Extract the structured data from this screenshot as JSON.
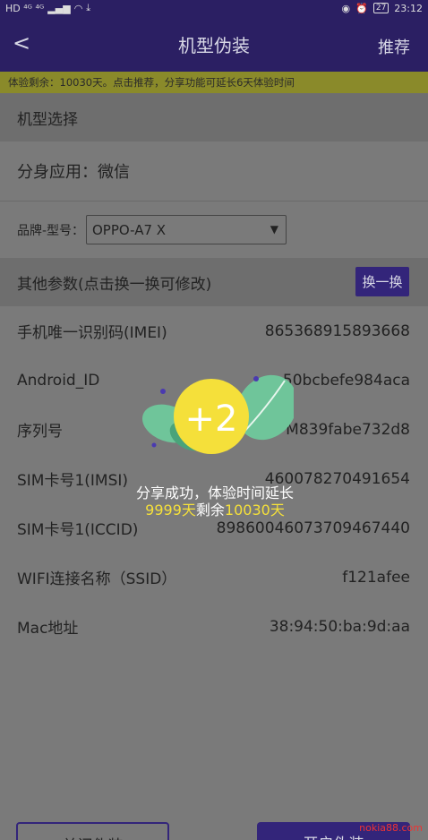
{
  "status": {
    "left": "HD ⁴ᴳ ⁴ᴳ",
    "battery": "27",
    "time": "23:12"
  },
  "appbar": {
    "back": "<",
    "title": "机型伪装",
    "action": "推荐"
  },
  "trial_banner": "体验剩余：10030天。点击推荐，分享功能可延长6天体验时间",
  "section_model": "机型选择",
  "clone_app": "分身应用：微信",
  "brand_label": "品牌-型号：",
  "brand_value": "OPPO-A7 X",
  "section_other": "其他参数(点击换一换可修改)",
  "swap_button": "换一换",
  "params": [
    {
      "label": "手机唯一识别码(IMEI)",
      "value": "865368915893668"
    },
    {
      "label": "Android_ID",
      "value": "ee50bcbefe984aca"
    },
    {
      "label": "序列号",
      "value": "M839fabe732d8"
    },
    {
      "label": "SIM卡号1(IMSI)",
      "value": "460078270491654"
    },
    {
      "label": "SIM卡号1(ICCID)",
      "value": "89860046073709467440"
    },
    {
      "label": "WIFI连接名称（SSID）",
      "value": "f121afee"
    },
    {
      "label": "Mac地址",
      "value": "38:94:50:ba:9d:aa"
    }
  ],
  "popup": {
    "badge": "+2",
    "message": "分享成功，体验时间延长",
    "days_added": "9999天",
    "remaining_label": "剩余",
    "remaining_days": "10030天"
  },
  "buttons": {
    "close": "关闭伪装",
    "confirm": "开启伪装"
  },
  "watermark": "nokia88.com",
  "colors": {
    "primary": "#33257a",
    "banner": "#8a8a2a",
    "highlight": "#f5e03a"
  }
}
